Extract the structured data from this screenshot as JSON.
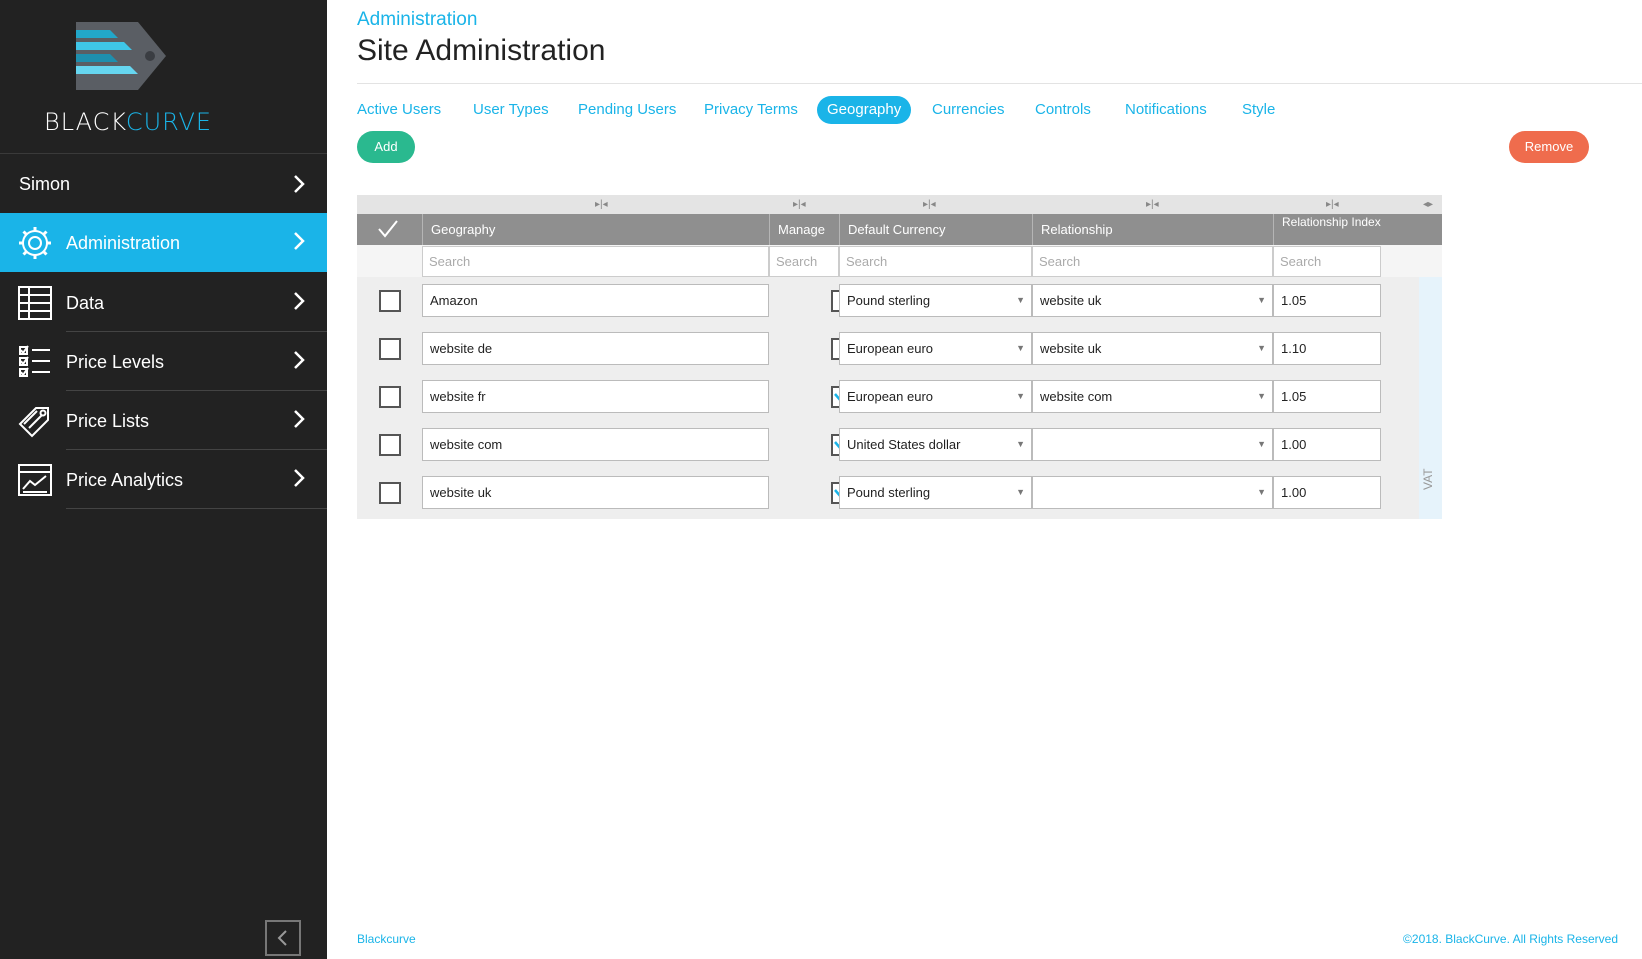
{
  "brand": {
    "logo_black": "BLACK",
    "logo_curve": "CURVE",
    "accent": "#1ab4e8"
  },
  "sidebar": {
    "user": "Simon",
    "items": [
      {
        "label": "Administration",
        "icon": "gear-icon",
        "active": true
      },
      {
        "label": "Data",
        "icon": "table-icon"
      },
      {
        "label": "Price Levels",
        "icon": "checklist-icon"
      },
      {
        "label": "Price Lists",
        "icon": "tag-icon"
      },
      {
        "label": "Price Analytics",
        "icon": "chart-icon"
      }
    ]
  },
  "header": {
    "breadcrumb": "Administration",
    "title": "Site Administration"
  },
  "tabs": [
    {
      "label": "Active Users"
    },
    {
      "label": "User Types"
    },
    {
      "label": "Pending Users"
    },
    {
      "label": "Privacy Terms"
    },
    {
      "label": "Geography",
      "active": true
    },
    {
      "label": "Currencies"
    },
    {
      "label": "Controls"
    },
    {
      "label": "Notifications"
    },
    {
      "label": "Style"
    }
  ],
  "actions": {
    "add": "Add",
    "remove": "Remove"
  },
  "grid": {
    "columns": {
      "geography": "Geography",
      "manage": "Manage",
      "default_currency": "Default Currency",
      "relationship": "Relationship",
      "relationship_index": "Relationship Index"
    },
    "search_placeholder": "Search",
    "side_tab": "VAT",
    "rows": [
      {
        "geography": "Amazon",
        "manage": false,
        "currency": "Pound sterling",
        "relationship": "website uk",
        "index": "1.05"
      },
      {
        "geography": "website de",
        "manage": false,
        "currency": "European euro",
        "relationship": "website uk",
        "index": "1.10"
      },
      {
        "geography": "website fr",
        "manage": true,
        "currency": "European euro",
        "relationship": "website com",
        "index": "1.05"
      },
      {
        "geography": "website com",
        "manage": true,
        "currency": "United States dollar",
        "relationship": "",
        "index": "1.00"
      },
      {
        "geography": "website uk",
        "manage": true,
        "currency": "Pound sterling",
        "relationship": "",
        "index": "1.00"
      }
    ]
  },
  "footer": {
    "left": "Blackcurve",
    "right": "©2018. BlackCurve. All Rights Reserved"
  }
}
